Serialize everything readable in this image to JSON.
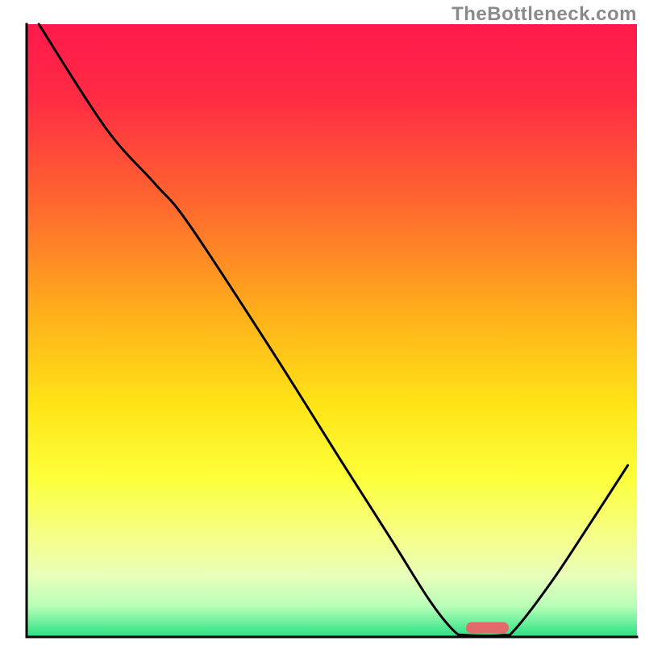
{
  "watermark": "TheBottleneck.com",
  "chart_data": {
    "type": "line",
    "title": "",
    "xlabel": "",
    "ylabel": "",
    "xlim": [
      0,
      100
    ],
    "ylim": [
      0,
      100
    ],
    "grid": false,
    "legend": false,
    "gradient_stops": [
      {
        "offset": 0.0,
        "color": "#ff1a4b"
      },
      {
        "offset": 0.12,
        "color": "#ff2b44"
      },
      {
        "offset": 0.3,
        "color": "#ff6a2e"
      },
      {
        "offset": 0.48,
        "color": "#ffb21a"
      },
      {
        "offset": 0.62,
        "color": "#ffe417"
      },
      {
        "offset": 0.74,
        "color": "#fdff3a"
      },
      {
        "offset": 0.84,
        "color": "#f5ff8c"
      },
      {
        "offset": 0.9,
        "color": "#e9ffba"
      },
      {
        "offset": 0.95,
        "color": "#b8ffb8"
      },
      {
        "offset": 1.0,
        "color": "#27e183"
      }
    ],
    "curve_points": [
      {
        "x": 2.0,
        "y": 100.0
      },
      {
        "x": 13.0,
        "y": 83.0
      },
      {
        "x": 21.0,
        "y": 74.0
      },
      {
        "x": 26.5,
        "y": 67.5
      },
      {
        "x": 40.0,
        "y": 47.0
      },
      {
        "x": 52.0,
        "y": 28.0
      },
      {
        "x": 60.0,
        "y": 15.5
      },
      {
        "x": 66.0,
        "y": 6.0
      },
      {
        "x": 70.0,
        "y": 1.0
      },
      {
        "x": 72.0,
        "y": 0.3
      },
      {
        "x": 78.0,
        "y": 0.3
      },
      {
        "x": 80.0,
        "y": 1.2
      },
      {
        "x": 86.0,
        "y": 9.0
      },
      {
        "x": 92.0,
        "y": 18.0
      },
      {
        "x": 98.5,
        "y": 28.0
      }
    ],
    "marker": {
      "x_start": 72.0,
      "x_end": 79.0,
      "y": 1.5,
      "color": "#e26a6a"
    },
    "axis": {
      "stroke": "#000000",
      "stroke_width": 3
    },
    "curve_style": {
      "stroke": "#000000",
      "stroke_width": 3
    }
  }
}
